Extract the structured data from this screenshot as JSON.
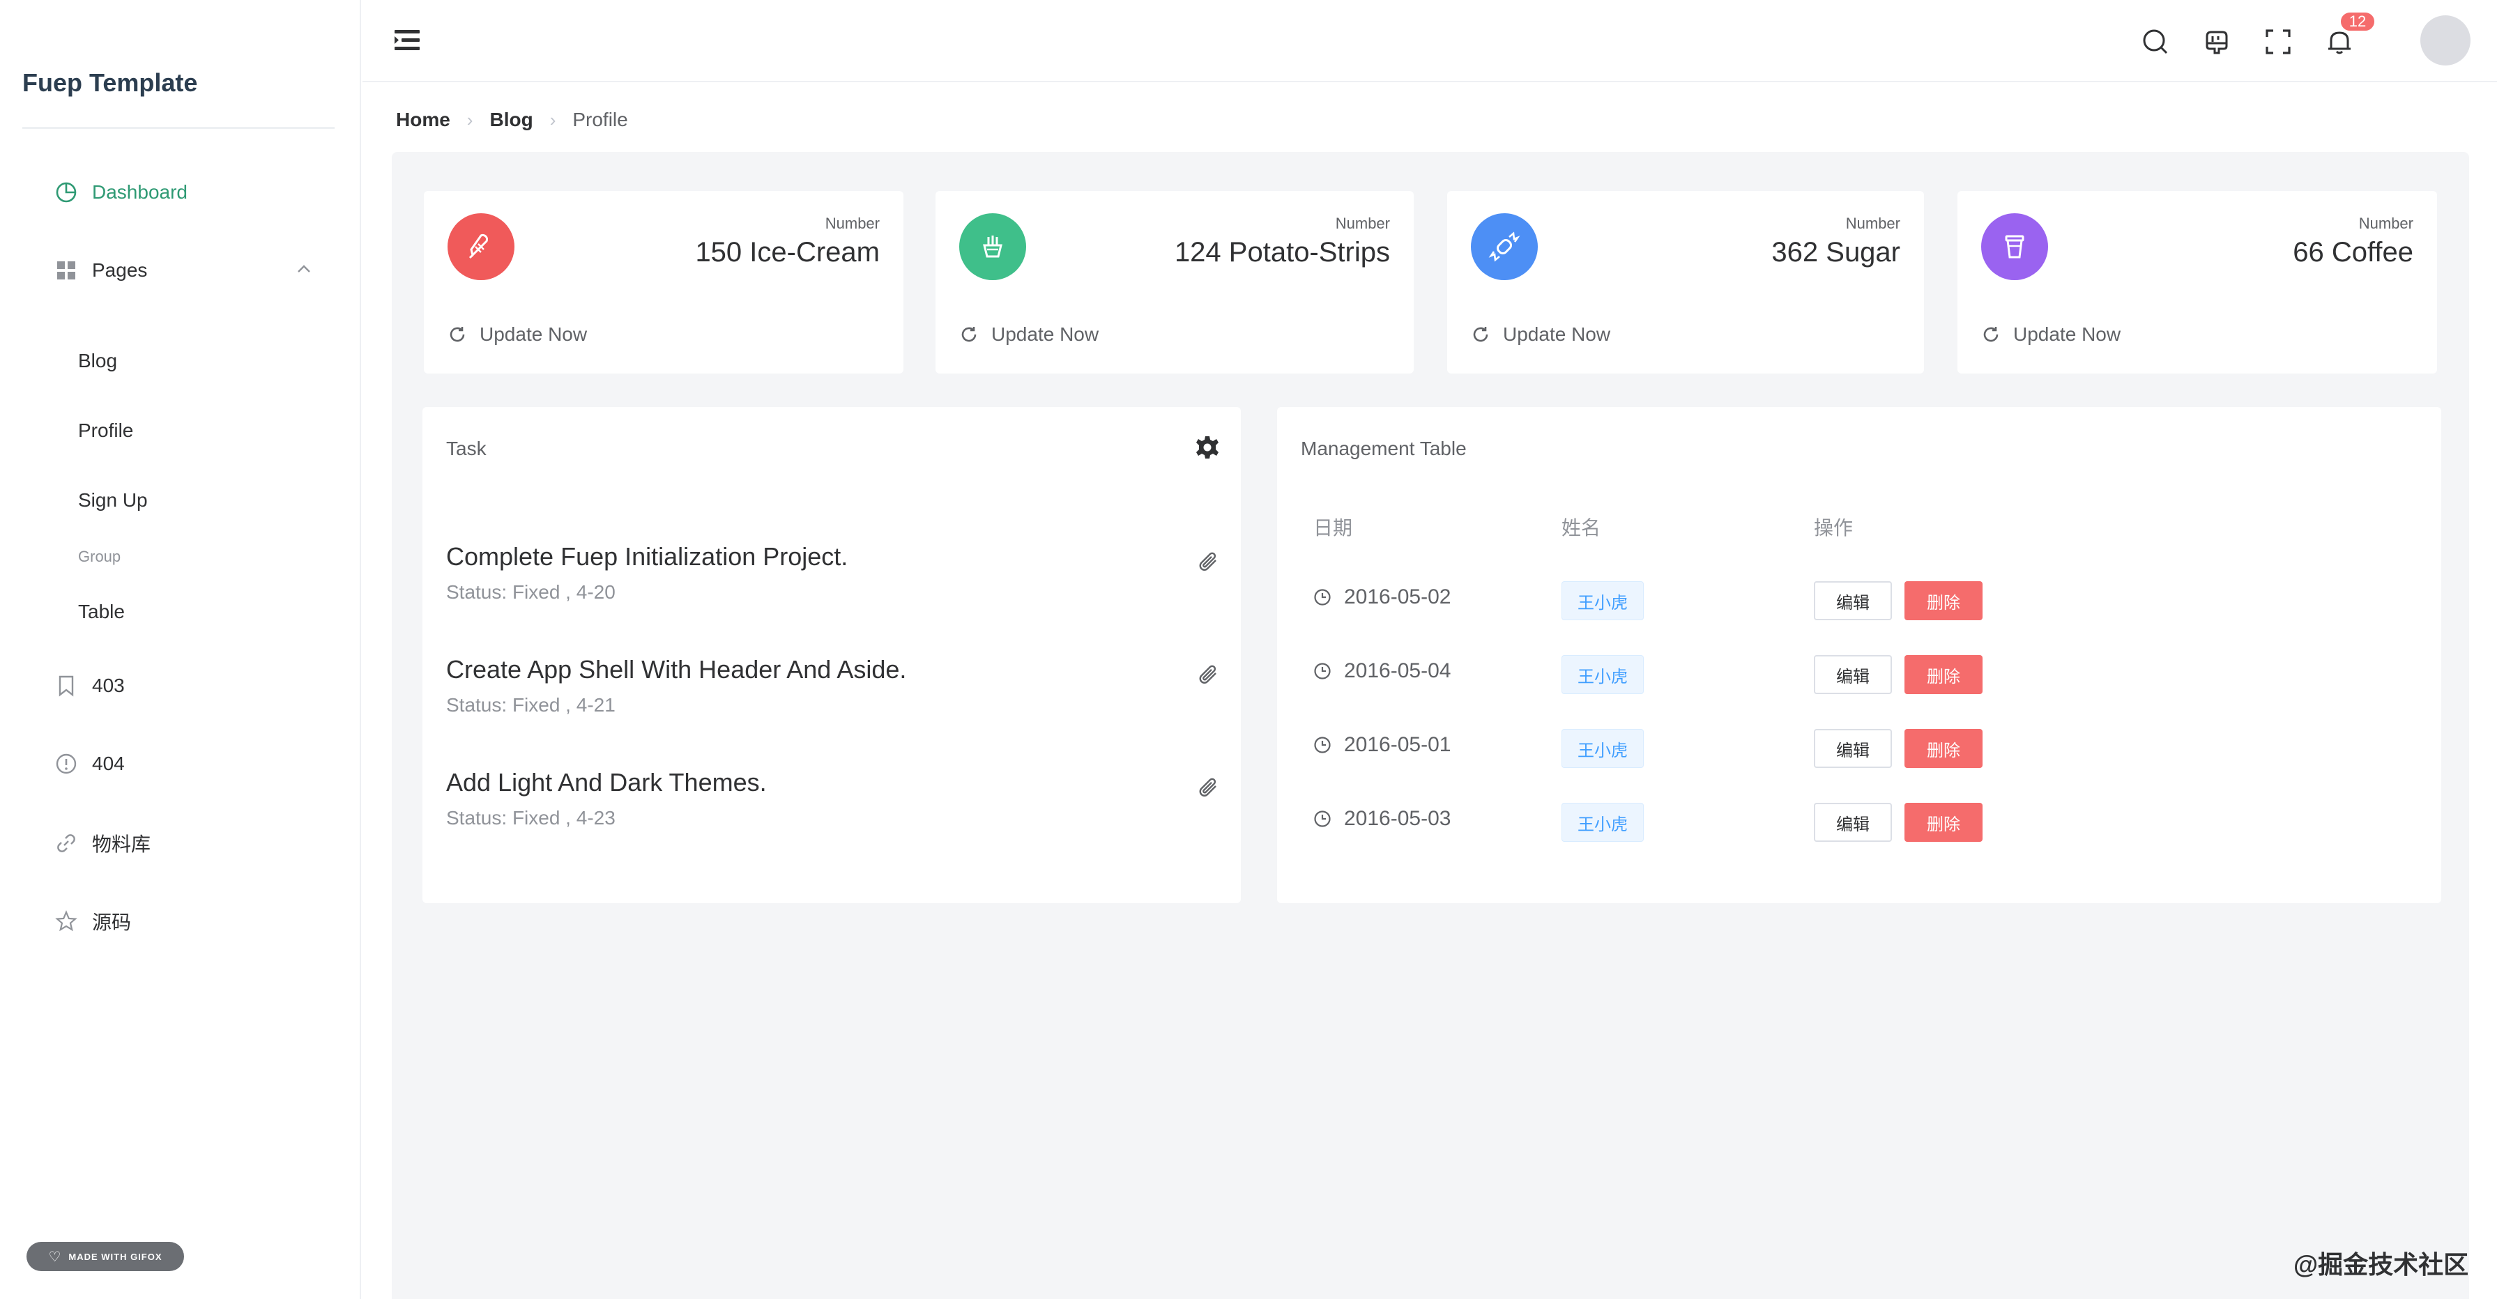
{
  "sidebar": {
    "brand": "Fuep Template",
    "menu": {
      "dashboard": "Dashboard",
      "pages": "Pages",
      "blog": "Blog",
      "profile": "Profile",
      "signup": "Sign Up",
      "group": "Group",
      "table": "Table",
      "e403": "403",
      "e404": "404",
      "materials": "物料库",
      "source": "源码"
    },
    "gifox": "MADE WITH GIFOX",
    "active_color": "#2f9a74"
  },
  "header": {
    "notification_count": "12"
  },
  "breadcrumb": {
    "home": "Home",
    "blog": "Blog",
    "current": "Profile"
  },
  "stats": [
    {
      "label": "Number",
      "value": "150 Ice-Cream",
      "footer": "Update Now",
      "color": "#f05a5a",
      "icon": "ice-cream-icon"
    },
    {
      "label": "Number",
      "value": "124 Potato-Strips",
      "footer": "Update Now",
      "color": "#3fbf8a",
      "icon": "fries-icon"
    },
    {
      "label": "Number",
      "value": "362 Sugar",
      "footer": "Update Now",
      "color": "#4d8ff5",
      "icon": "candy-icon"
    },
    {
      "label": "Number",
      "value": "66 Coffee",
      "footer": "Update Now",
      "color": "#9a63f0",
      "icon": "cup-icon"
    }
  ],
  "tasks": {
    "title": "Task",
    "items": [
      {
        "title": "Complete Fuep Initialization Project.",
        "status": "Status: Fixed , 4-20"
      },
      {
        "title": "Create App Shell With Header And Aside.",
        "status": "Status: Fixed , 4-21"
      },
      {
        "title": "Add Light And Dark Themes.",
        "status": "Status: Fixed , 4-23"
      }
    ]
  },
  "table": {
    "title": "Management Table",
    "headers": {
      "date": "日期",
      "name": "姓名",
      "action": "操作"
    },
    "rows": [
      {
        "date": "2016-05-02",
        "name": "王小虎",
        "edit": "编辑",
        "del": "删除"
      },
      {
        "date": "2016-05-04",
        "name": "王小虎",
        "edit": "编辑",
        "del": "删除"
      },
      {
        "date": "2016-05-01",
        "name": "王小虎",
        "edit": "编辑",
        "del": "删除"
      },
      {
        "date": "2016-05-03",
        "name": "王小虎",
        "edit": "编辑",
        "del": "删除"
      }
    ]
  },
  "watermark": "@掘金技术社区"
}
